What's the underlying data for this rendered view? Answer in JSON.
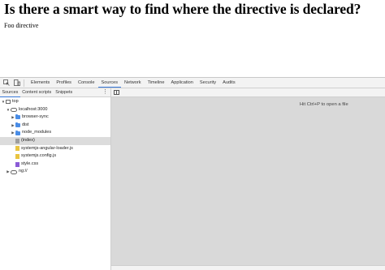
{
  "page": {
    "heading": "Is there a smart way to find where the directive is declared?",
    "body_text": "Foo directive"
  },
  "devtools": {
    "tabs": [
      "Elements",
      "Profiles",
      "Console",
      "Sources",
      "Network",
      "Timeline",
      "Application",
      "Security",
      "Audits"
    ],
    "active_tab": "Sources",
    "navigator_tabs": [
      "Sources",
      "Content scripts",
      "Snippets"
    ],
    "tree": {
      "top": "top",
      "host": "localhost:3000",
      "folders": [
        "browser-sync",
        "dist",
        "node_modules"
      ],
      "files": [
        "(index)",
        "systemjs-angular-loader.js",
        "systemjs.config.js",
        "style.css"
      ],
      "selected_file": "(index)",
      "ng": "ng://"
    },
    "editor_hint": "Hit Ctrl+P to open a file"
  }
}
